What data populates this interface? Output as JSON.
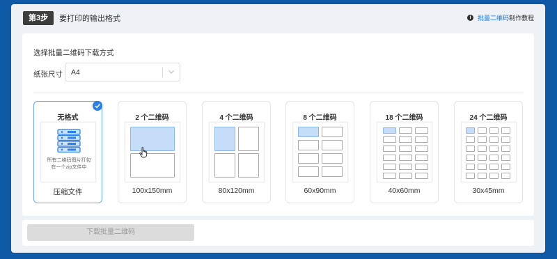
{
  "step": {
    "badge": "第3步",
    "title": "要打印的输出格式",
    "help_link": "批量二维码",
    "help_suffix": "制作教程"
  },
  "panel": {
    "section_title": "选择批量二维码下载方式",
    "paper_label": "纸张尺寸",
    "paper_value": "A4"
  },
  "formats": [
    {
      "name": "无格式",
      "size": "压缩文件",
      "selected": true,
      "icon": "zip-archive-icon",
      "description": "所有二维码图片打包在一个zip文件中"
    },
    {
      "name": "2 个二维码",
      "size": "100x150mm",
      "selected": false
    },
    {
      "name": "4 个二维码",
      "size": "80x120mm",
      "selected": false
    },
    {
      "name": "8 个二维码",
      "size": "60x90mm",
      "selected": false
    },
    {
      "name": "18 个二维码",
      "size": "40x60mm",
      "selected": false
    },
    {
      "name": "24 个二维码",
      "size": "30x45mm",
      "selected": false
    }
  ],
  "download_button": "下载批量二维码",
  "colors": {
    "accent": "#2f80e0",
    "highlight": "#c7defa",
    "background": "#0f5aa7"
  }
}
